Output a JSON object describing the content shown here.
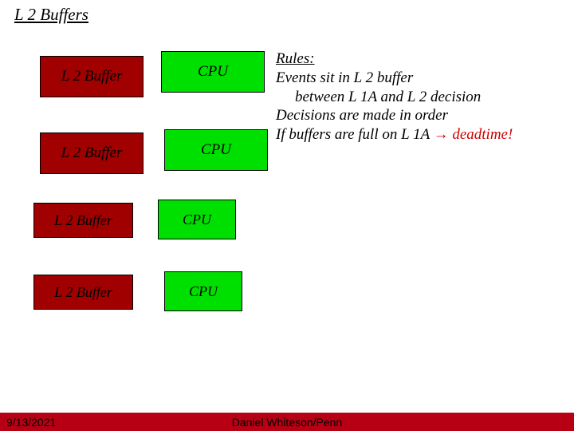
{
  "title": "L 2 Buffers",
  "buffers": [
    "L 2 Buffer",
    "L 2 Buffer",
    "L 2 Buffer",
    "L 2 Buffer"
  ],
  "cpus": [
    "CPU",
    "CPU",
    "CPU",
    "CPU"
  ],
  "rules": {
    "heading": "Rules:",
    "line1": "Events sit in  L 2 buffer",
    "line1b": "between L 1A and L 2 decision",
    "line2": "Decisions are made in order",
    "line3a": "If buffers are full on L 1A ",
    "arrow": "→",
    "line3b": " deadtime!"
  },
  "footer": {
    "date": "9/13/2021",
    "credit": "Daniel Whiteson/Penn"
  }
}
